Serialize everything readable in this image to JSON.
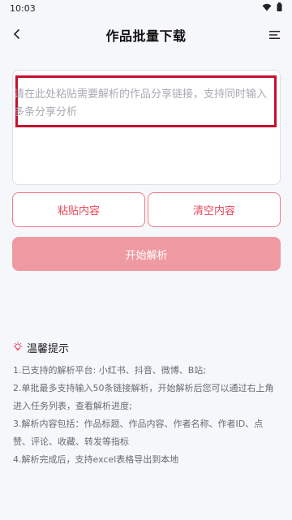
{
  "status_bar": {
    "time": "10:03",
    "icons": [
      "wifi-icon",
      "battery-icon"
    ]
  },
  "app_bar": {
    "title": "作品批量下载",
    "back_icon": "chevron-left-icon",
    "menu_icon": "list-menu-icon"
  },
  "input": {
    "placeholder": "请在此处粘贴需要解析的作品分享链接，支持同时输入多条分享分析",
    "highlight_color": "#c8102e"
  },
  "buttons": {
    "paste_label": "粘贴内容",
    "clear_label": "清空内容",
    "start_label": "开始解析"
  },
  "tips": {
    "icon": "lightbulb-icon",
    "title": "温馨提示",
    "items": [
      "1.已支持的解析平台: 小红书、抖音、微博、B站;",
      "2.单批最多支持输入50条链接解析，开始解析后您可以通过右上角进入任务列表，查看解析进度;",
      "3.解析内容包括：作品标题、作品内容、作者名称、作者ID、点赞、评论、收藏、转发等指标",
      "4.解析完成后，支持excel表格导出到本地"
    ]
  },
  "colors": {
    "accent": "#e5485a",
    "start_button": "#ef9aa1",
    "background": "#f6f7fb"
  }
}
